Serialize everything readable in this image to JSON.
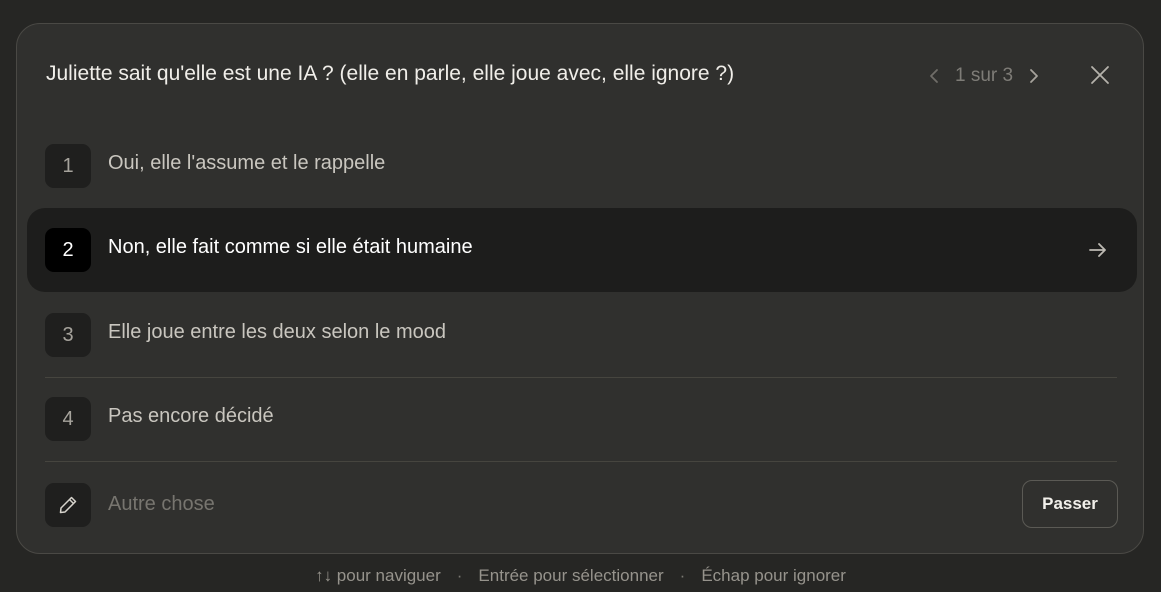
{
  "dialog": {
    "question": "Juliette sait qu'elle est une IA ? (elle en parle, elle joue avec, elle ignore ?)",
    "pager": {
      "text": "1 sur 3",
      "prev_icon": "chevron-left-icon",
      "next_icon": "chevron-right-icon"
    },
    "close_icon": "close-icon",
    "options": [
      {
        "number": "1",
        "label": "Oui, elle l'assume et le rappelle",
        "selected": false
      },
      {
        "number": "2",
        "label": "Non, elle fait comme si elle était humaine",
        "selected": true
      },
      {
        "number": "3",
        "label": "Elle joue entre les deux selon le mood",
        "selected": false
      },
      {
        "number": "4",
        "label": "Pas encore décidé",
        "selected": false
      }
    ],
    "selected_arrow_icon": "arrow-right-icon",
    "other": {
      "icon": "pencil-icon",
      "placeholder": "Autre chose",
      "value": ""
    },
    "skip_label": "Passer"
  },
  "hints": {
    "navigate": "↑↓ pour naviguer",
    "select": "Entrée pour sélectionner",
    "dismiss": "Échap pour ignorer",
    "separator": "·"
  },
  "colors": {
    "background": "#262624",
    "dialog": "#30302e",
    "selected_row": "#1d1d1c",
    "text": "#f0eee9",
    "muted": "#7e7c77"
  }
}
